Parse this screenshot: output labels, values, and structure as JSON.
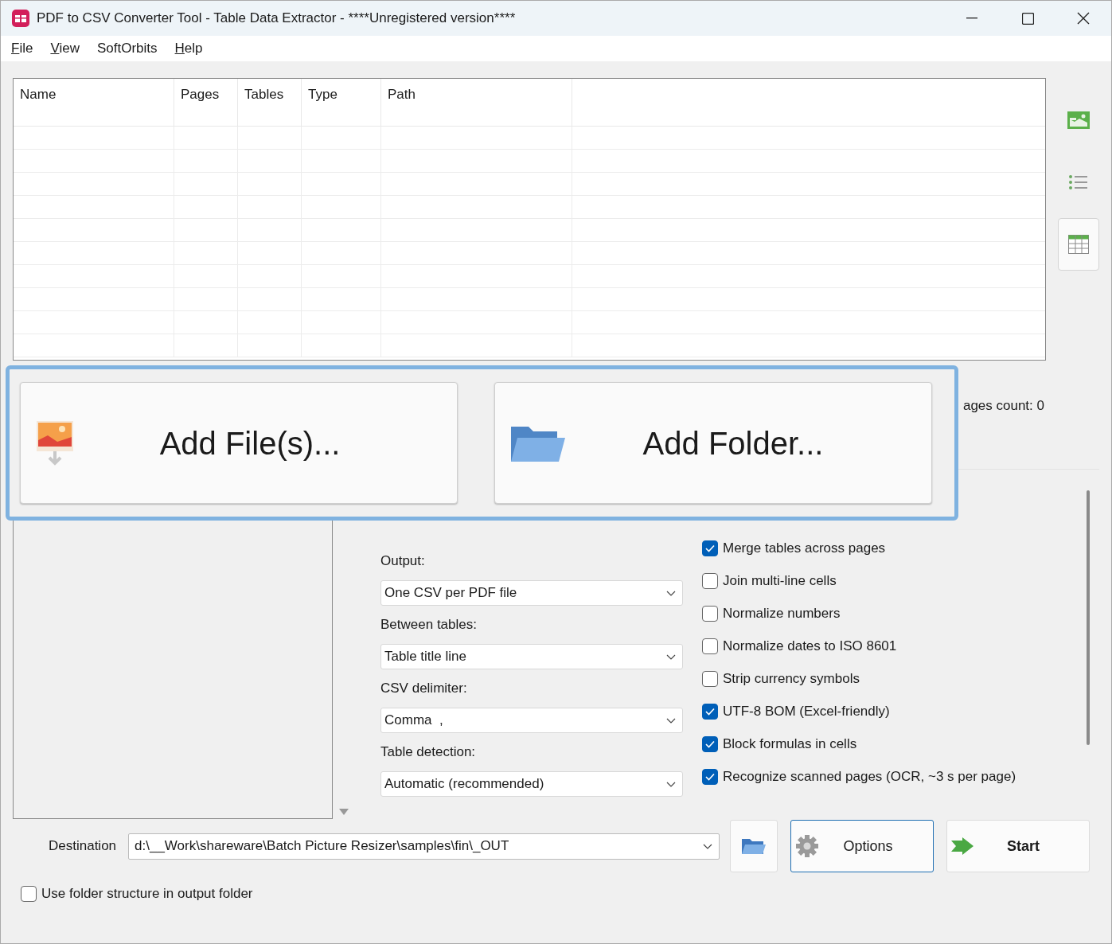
{
  "window": {
    "title": "PDF to CSV Converter Tool - Table Data Extractor - ****Unregistered version****"
  },
  "menu": [
    {
      "label": "File",
      "mnemonic": true
    },
    {
      "label": "View",
      "mnemonic": true
    },
    {
      "label": "SoftOrbits",
      "mnemonic": false
    },
    {
      "label": "Help",
      "mnemonic": true
    }
  ],
  "table": {
    "columns": [
      "Name",
      "Pages",
      "Tables",
      "Type",
      "Path"
    ]
  },
  "view_buttons": [
    {
      "kind": "picture",
      "selected": false
    },
    {
      "kind": "list",
      "selected": false
    },
    {
      "kind": "table",
      "selected": true
    }
  ],
  "status": "ages count: 0",
  "add_buttons": [
    {
      "kind": "files",
      "label": "Add File(s)..."
    },
    {
      "kind": "folder",
      "label": "Add Folder..."
    }
  ],
  "settings": [
    {
      "kind": "label",
      "text": "Output:"
    },
    {
      "kind": "select",
      "text": "One CSV per PDF file"
    },
    {
      "kind": "label",
      "text": "Between tables:"
    },
    {
      "kind": "select",
      "text": "Table title line"
    },
    {
      "kind": "label",
      "text": "CSV delimiter:"
    },
    {
      "kind": "select",
      "text": "Comma  ,"
    },
    {
      "kind": "label",
      "text": "Table detection:"
    },
    {
      "kind": "select",
      "text": "Automatic (recommended)"
    }
  ],
  "options": [
    {
      "label": "Merge tables across pages",
      "checked": true
    },
    {
      "label": "Join multi-line cells",
      "checked": false
    },
    {
      "label": "Normalize numbers",
      "checked": false
    },
    {
      "label": "Normalize dates to ISO 8601",
      "checked": false
    },
    {
      "label": "Strip currency symbols",
      "checked": false
    },
    {
      "label": "UTF-8 BOM (Excel-friendly)",
      "checked": true
    },
    {
      "label": "Block formulas in cells",
      "checked": true
    },
    {
      "label": "Recognize scanned pages (OCR, ~3 s per page)",
      "checked": true
    }
  ],
  "destination": {
    "label": "Destination",
    "value": "d:\\__Work\\shareware\\Batch Picture Resizer\\samples\\fin\\_OUT"
  },
  "actions": [
    {
      "kind": "browse",
      "focused": false
    },
    {
      "kind": "options",
      "label": "Options",
      "focused": true
    },
    {
      "kind": "start",
      "label": "Start",
      "focused": false
    }
  ],
  "use_folder_structure": {
    "label": "Use folder structure in output folder",
    "checked": false
  }
}
